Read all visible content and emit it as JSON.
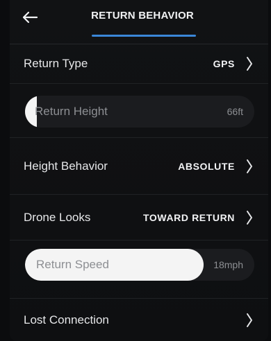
{
  "header": {
    "title": "RETURN BEHAVIOR"
  },
  "rows": {
    "return_type": {
      "label": "Return Type",
      "value": "GPS"
    },
    "height_behavior": {
      "label": "Height Behavior",
      "value": "ABSOLUTE"
    },
    "drone_looks": {
      "label": "Drone Looks",
      "value": "TOWARD RETURN"
    },
    "lost_connection": {
      "label": "Lost Connection"
    }
  },
  "sliders": {
    "return_height": {
      "label": "Return Height",
      "value": "66ft",
      "fill_fraction": 0.05
    },
    "return_speed": {
      "label": "Return Speed",
      "value": "18mph",
      "fill_fraction": 0.78
    }
  },
  "colors": {
    "accent": "#3b87d9",
    "background": "#0e0f11",
    "slider_fill": "#f4f4f4"
  },
  "icons": {
    "back": "arrow-left-icon",
    "chevron": "chevron-right-icon"
  }
}
